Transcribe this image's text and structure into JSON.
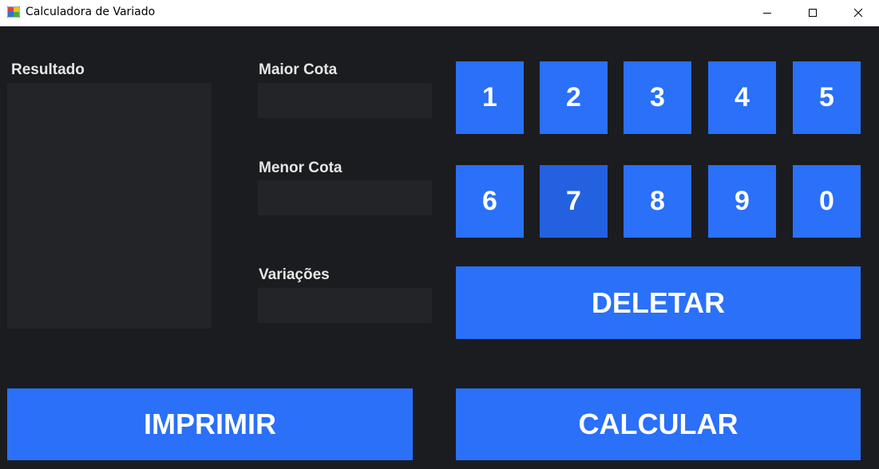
{
  "window": {
    "title": "Calculadora de Variado"
  },
  "titlebar_icons": {
    "app": "app-icon",
    "minimize": "minimize-icon",
    "maximize": "maximize-icon",
    "close": "close-icon"
  },
  "labels": {
    "resultado": "Resultado",
    "maior_cota": "Maior Cota",
    "menor_cota": "Menor Cota",
    "variacoes": "Variações"
  },
  "fields": {
    "resultado": "",
    "maior_cota": "",
    "menor_cota": "",
    "variacoes": ""
  },
  "keypad": {
    "row1": [
      "1",
      "2",
      "3",
      "4",
      "5"
    ],
    "row2": [
      "6",
      "7",
      "8",
      "9",
      "0"
    ],
    "pressed_key": "7"
  },
  "buttons": {
    "deletar": "DELETAR",
    "imprimir": "IMPRIMIR",
    "calcular": "CALCULAR"
  },
  "colors": {
    "background": "#1b1c1f",
    "field": "#222428",
    "button": "#2a70f8",
    "button_pressed": "#2461e0",
    "text": "#e6e6e6"
  }
}
